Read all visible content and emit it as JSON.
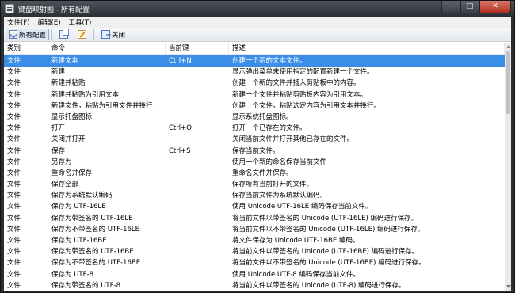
{
  "window": {
    "title": "键盘映射图 - 所有配置",
    "minimize_label": "–",
    "maximize_label": "□",
    "close_label": "✕"
  },
  "menubar": {
    "items": [
      "文件(F)",
      "编辑(E)",
      "工具(T)"
    ]
  },
  "toolbar": {
    "all_configs_label": "所有配置",
    "copy_icon": "copy-icon",
    "edit_icon": "edit-icon",
    "close_label": "关闭"
  },
  "table": {
    "columns": [
      "类别",
      "命令",
      "当前键",
      "描述"
    ],
    "rows": [
      {
        "category": "文件",
        "command": "新建文本",
        "shortcut": "Ctrl+N",
        "description": "创建一个新的文本文件。",
        "selected": true
      },
      {
        "category": "文件",
        "command": "新建",
        "shortcut": "",
        "description": "显示弹出菜单来使用指定的配置新建一个文件。"
      },
      {
        "category": "文件",
        "command": "新建并粘贴",
        "shortcut": "",
        "description": "创建一个新的文件并插入剪贴板中的内容。"
      },
      {
        "category": "文件",
        "command": "新建并粘贴为引用文本",
        "shortcut": "",
        "description": "新建一个文件并粘贴剪贴板内容为引用文本。"
      },
      {
        "category": "文件",
        "command": "新建文件，粘贴为引用文件并换行",
        "shortcut": "",
        "description": "创建一个文件，粘贴选定内容为引用文本并换行。"
      },
      {
        "category": "文件",
        "command": "显示托盘图标",
        "shortcut": "",
        "description": "显示系统托盘图标。"
      },
      {
        "category": "文件",
        "command": "打开",
        "shortcut": "Ctrl+O",
        "description": "打开一个已存在的文件。"
      },
      {
        "category": "文件",
        "command": "关闭并打开",
        "shortcut": "",
        "description": "关闭当前文件并打开其他已存在的文件。"
      },
      {
        "category": "文件",
        "command": "保存",
        "shortcut": "Ctrl+S",
        "description": "保存当前文件。"
      },
      {
        "category": "文件",
        "command": "另存为",
        "shortcut": "",
        "description": "使用一个新的命名保存当前文件"
      },
      {
        "category": "文件",
        "command": "重命名并保存",
        "shortcut": "",
        "description": "重命名文件并保存。"
      },
      {
        "category": "文件",
        "command": "保存全部",
        "shortcut": "",
        "description": "保存所有当前打开的文件。"
      },
      {
        "category": "文件",
        "command": "保存为系统默认编码",
        "shortcut": "",
        "description": "保存当前文件为系统默认编码。"
      },
      {
        "category": "文件",
        "command": "保存为 UTF-16LE",
        "shortcut": "",
        "description": "使用 Unicode UTF-16LE 编码保存当前文件。"
      },
      {
        "category": "文件",
        "command": "保存为带签名的 UTF-16LE",
        "shortcut": "",
        "description": "将当前文件以带签名的 Unicode (UTF-16LE) 编码进行保存。"
      },
      {
        "category": "文件",
        "command": "保存为不带签名的 UTF-16LE",
        "shortcut": "",
        "description": "将当前文件以不带签名的 Unicode (UTF-16LE) 编码进行保存。"
      },
      {
        "category": "文件",
        "command": "保存为 UTF-16BE",
        "shortcut": "",
        "description": "将文件保存为 Unicode UTF-16BE 编码。"
      },
      {
        "category": "文件",
        "command": "保存为带签名的 UTF-16BE",
        "shortcut": "",
        "description": "将当前文件以带签名的 Unicode (UTF-16BE) 编码进行保存。"
      },
      {
        "category": "文件",
        "command": "保存为不带签名的 UTF-16BE",
        "shortcut": "",
        "description": "将当前文件以不带签名的 Unicode (UTF-16BE) 编码进行保存。"
      },
      {
        "category": "文件",
        "command": "保存为 UTF-8",
        "shortcut": "",
        "description": "使用 Unicode UTF-8 编码保存当前文件。"
      },
      {
        "category": "文件",
        "command": "保存为带签名的 UTF-8",
        "shortcut": "",
        "description": "将当前文件以带签名的 Unicode (UTF-8) 编码进行保存。"
      }
    ]
  },
  "colors": {
    "selection": "#3a8ee6",
    "titlebar": "#2b3037",
    "close_button": "#c7402c"
  }
}
